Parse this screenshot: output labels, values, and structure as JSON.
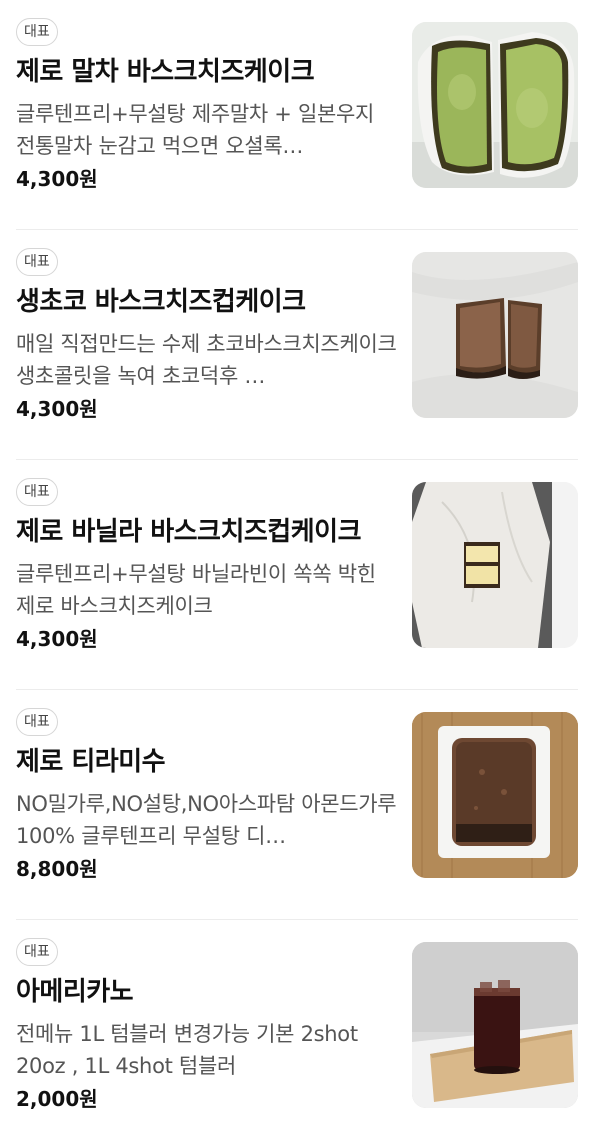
{
  "menu": {
    "items": [
      {
        "badge": "대표",
        "name": "제로 말차 바스크치즈케이크",
        "description": "글루텐프리+무설탕 제주말차 + 일본우지 전통말차 눈감고 먹으면 오셜록…",
        "price": "4,300원"
      },
      {
        "badge": "대표",
        "name": "생초코 바스크치즈컵케이크",
        "description": "매일 직접만드는 수제 초코바스크치즈케이크 생초콜릿을 녹여 초코덕후 …",
        "price": "4,300원"
      },
      {
        "badge": "대표",
        "name": "제로 바닐라 바스크치즈컵케이크",
        "description": "글루텐프리+무설탕 바닐라빈이 쏙쏙 박힌 제로 바스크치즈케이크",
        "price": "4,300원"
      },
      {
        "badge": "대표",
        "name": "제로 티라미수",
        "description": "NO밀가루,NO설탕,NO아스파탐 아몬드가루 100% 글루텐프리 무설탕 디…",
        "price": "8,800원"
      },
      {
        "badge": "대표",
        "name": "아메리카노",
        "description": "전메뉴 1L 텀블러 변경가능 기본 2shot 20oz , 1L 4shot 텀블러",
        "price": "2,000원"
      }
    ]
  }
}
